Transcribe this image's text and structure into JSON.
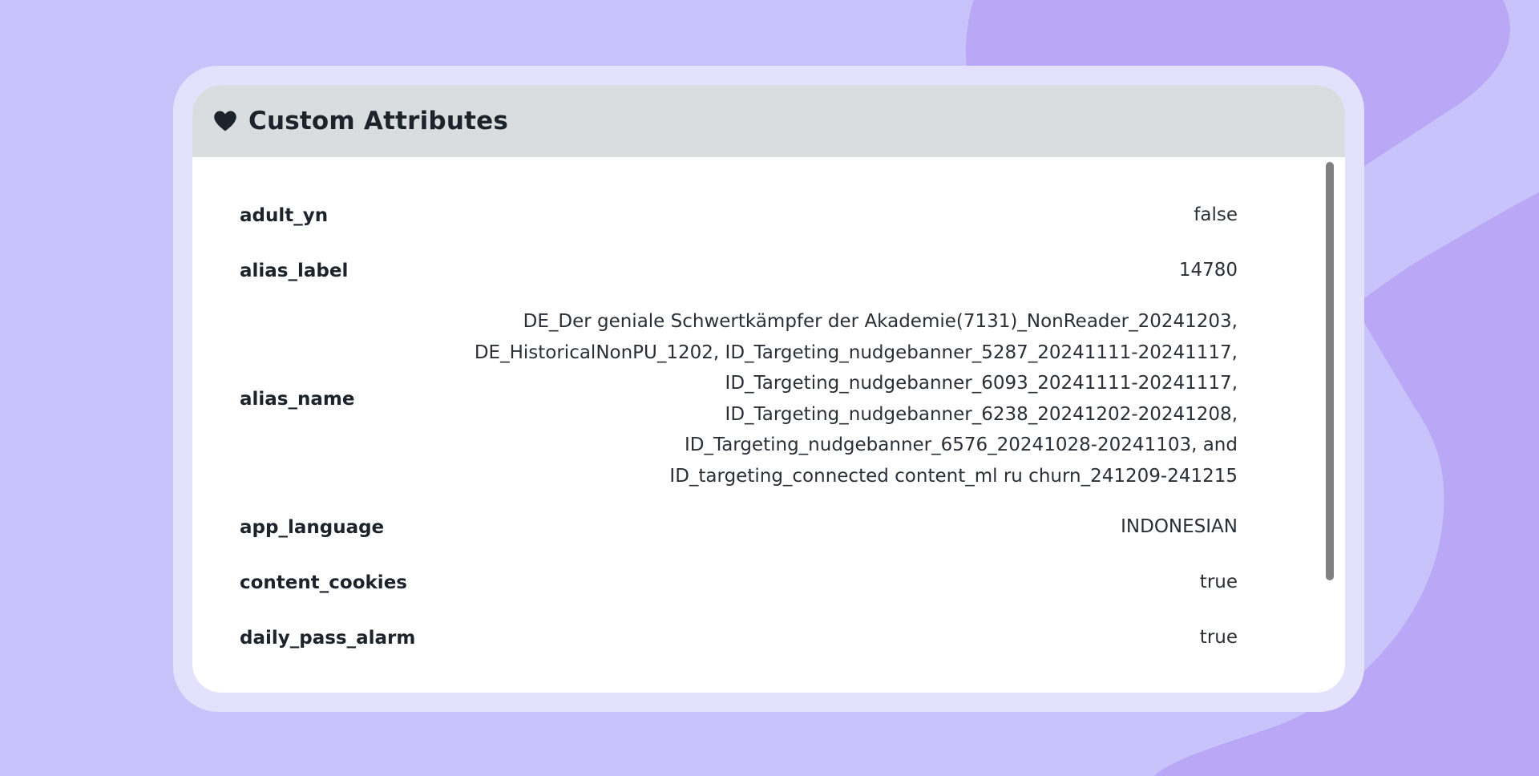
{
  "panel": {
    "title": "Custom Attributes",
    "icon": "heart-icon"
  },
  "attributes": [
    {
      "key": "adult_yn",
      "value_lines": [
        "false"
      ]
    },
    {
      "key": "alias_label",
      "value_lines": [
        "14780"
      ]
    },
    {
      "key": "alias_name",
      "value_lines": [
        "DE_Der geniale Schwertkämpfer der Akademie(7131)_NonReader_20241203,",
        "DE_HistoricalNonPU_1202, ID_Targeting_nudgebanner_5287_20241111-20241117,",
        "ID_Targeting_nudgebanner_6093_20241111-20241117,",
        "ID_Targeting_nudgebanner_6238_20241202-20241208,",
        "ID_Targeting_nudgebanner_6576_20241028-20241103, and",
        "ID_targeting_connected content_ml ru churn_241209-241215"
      ]
    },
    {
      "key": "app_language",
      "value_lines": [
        "INDONESIAN"
      ]
    },
    {
      "key": "content_cookies",
      "value_lines": [
        "true"
      ]
    },
    {
      "key": "daily_pass_alarm",
      "value_lines": [
        "true"
      ]
    }
  ],
  "colors": {
    "background": "#c9c3fb",
    "background_shape": "#baa8f6",
    "card_outer": "#e4e1fd",
    "header": "#d9dddf",
    "text": "#1d232b",
    "scrollbar": "#808080"
  }
}
